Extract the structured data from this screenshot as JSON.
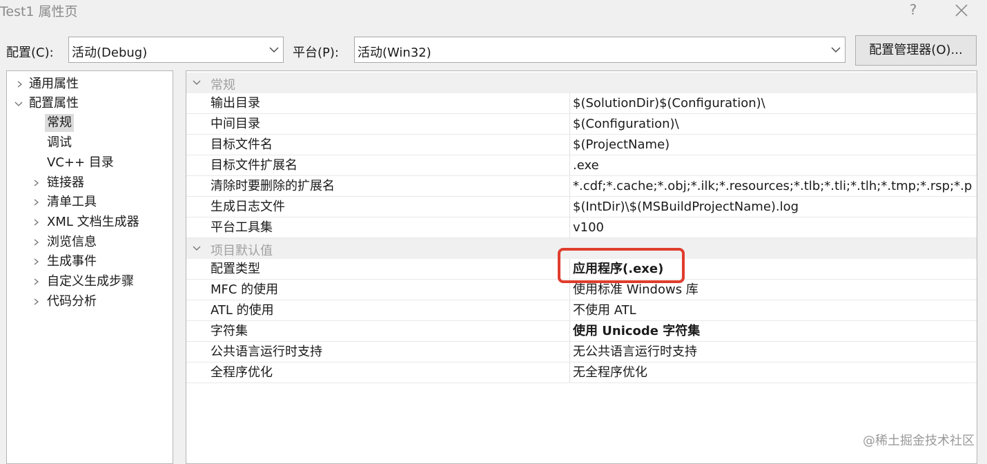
{
  "window": {
    "title": "Test1 属性页",
    "help": "?"
  },
  "toolbar": {
    "config_label": "配置(C):",
    "config_value": "活动(Debug)",
    "platform_label": "平台(P):",
    "platform_value": "活动(Win32)",
    "manager_button": "配置管理器(O)..."
  },
  "tree": {
    "items": [
      {
        "label": "通用属性"
      },
      {
        "label": "配置属性"
      },
      {
        "label": "常规"
      },
      {
        "label": "调试"
      },
      {
        "label": "VC++ 目录"
      },
      {
        "label": "链接器"
      },
      {
        "label": "清单工具"
      },
      {
        "label": "XML 文档生成器"
      },
      {
        "label": "浏览信息"
      },
      {
        "label": "生成事件"
      },
      {
        "label": "自定义生成步骤"
      },
      {
        "label": "代码分析"
      }
    ]
  },
  "grid": {
    "categories": [
      {
        "label": "常规"
      },
      {
        "label": "项目默认值"
      }
    ],
    "rows": [
      {
        "name": "输出目录",
        "value": "$(SolutionDir)$(Configuration)\\"
      },
      {
        "name": "中间目录",
        "value": "$(Configuration)\\"
      },
      {
        "name": "目标文件名",
        "value": "$(ProjectName)"
      },
      {
        "name": "目标文件扩展名",
        "value": ".exe"
      },
      {
        "name": "清除时要删除的扩展名",
        "value": "*.cdf;*.cache;*.obj;*.ilk;*.resources;*.tlb;*.tli;*.tlh;*.tmp;*.rsp;*.p"
      },
      {
        "name": "生成日志文件",
        "value": "$(IntDir)\\$(MSBuildProjectName).log"
      },
      {
        "name": "平台工具集",
        "value": "v100"
      },
      {
        "name": "配置类型",
        "value": "应用程序(.exe)"
      },
      {
        "name": "MFC 的使用",
        "value": "使用标准 Windows 库"
      },
      {
        "name": "ATL 的使用",
        "value": "不使用 ATL"
      },
      {
        "name": "字符集",
        "value": "使用 Unicode 字符集"
      },
      {
        "name": "公共语言运行时支持",
        "value": "无公共语言运行时支持"
      },
      {
        "name": "全程序优化",
        "value": "无全程序优化"
      }
    ]
  },
  "watermark": "@稀土掘金技术社区",
  "colors": {
    "highlight": "#e03c2d",
    "category_text": "#a0a0a0",
    "selected_bg": "#dcdcdc"
  }
}
